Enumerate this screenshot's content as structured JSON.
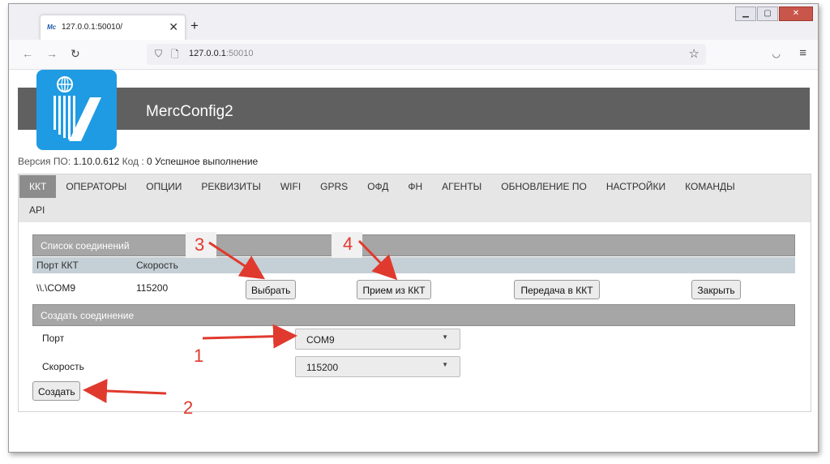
{
  "browser": {
    "tab_title": "127.0.0.1:50010/",
    "tab_favicon_text": "Mc",
    "url_host": "127.0.0.1",
    "url_port": ":50010"
  },
  "app": {
    "title": "MercConfig2",
    "version_label": "Версия ПО:",
    "version_value": "1.10.0.612",
    "code_label": "Код :",
    "code_value": "0",
    "status": "Успешное выполнение"
  },
  "tabs": {
    "row1": [
      "ККТ",
      "ОПЕРАТОРЫ",
      "ОПЦИИ",
      "РЕКВИЗИТЫ",
      "WIFI",
      "GPRS",
      "ОФД",
      "ФН",
      "АГЕНТЫ",
      "ОБНОВЛЕНИЕ ПО",
      "НАСТРОЙКИ",
      "КОМАНДЫ"
    ],
    "row2": [
      "API"
    ],
    "active": "ККТ"
  },
  "connections": {
    "section_title": "Список соединений",
    "columns": [
      "Порт ККТ",
      "Скорость"
    ],
    "rows": [
      {
        "port": "\\\\.\\COM9",
        "speed": "115200"
      }
    ],
    "buttons": {
      "select": "Выбрать",
      "receive": "Прием из ККТ",
      "transfer": "Передача в ККТ",
      "close": "Закрыть"
    }
  },
  "create": {
    "section_title": "Создать соединение",
    "port_label": "Порт",
    "port_value": "COM9",
    "speed_label": "Скорость",
    "speed_value": "115200",
    "create_button": "Создать"
  },
  "annotations": [
    "1",
    "2",
    "3",
    "4"
  ],
  "colors": {
    "header_bar": "#606060",
    "logo_bg": "#1e9be3",
    "active_tab": "#8c8c8c",
    "section_bg": "#a6a6a6",
    "column_header": "#c5cfd6",
    "annotation": "#e03a2e"
  }
}
